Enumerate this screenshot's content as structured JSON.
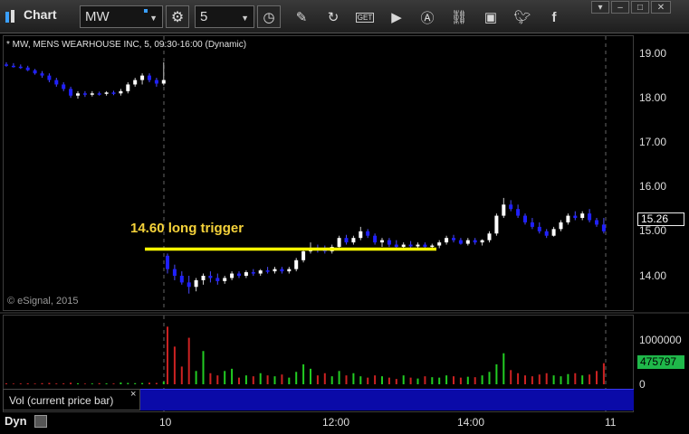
{
  "toolbar": {
    "app_title": "Chart",
    "symbol_value": "MW",
    "interval_value": "5"
  },
  "chart": {
    "symbol_info": "* MW, MENS WEARHOUSE INC, 5, 09:30-16:00 (Dynamic)",
    "copyright": "© eSignal, 2015",
    "annotation": "14.60 long trigger",
    "last_price": "15.26",
    "price_ticks": [
      "19.00",
      "18.00",
      "17.00",
      "16.00",
      "15.00",
      "14.00"
    ],
    "volume_label": "Vol (current price bar)",
    "volume_close": "×",
    "volume_ticks": [
      "1000000",
      "0"
    ],
    "volume_last": "475797",
    "time_ticks": [
      "10",
      "12:00",
      "14:00",
      "11"
    ],
    "bottom_label": "Dyn"
  },
  "colors": {
    "up_candle": "#ffffff",
    "down_candle": "#2020ff",
    "trigger_line": "#ffff00",
    "volume_up": "#22cc22",
    "volume_down": "#cc2222"
  },
  "chart_data": {
    "type": "candlestick",
    "ylim": [
      13.5,
      19.3
    ],
    "trigger_price": 14.6,
    "sessions": [
      {
        "label": "prior day",
        "candles": [
          [
            18.75,
            18.8,
            18.7,
            18.72
          ],
          [
            18.72,
            18.78,
            18.68,
            18.7
          ],
          [
            18.7,
            18.75,
            18.65,
            18.68
          ],
          [
            18.68,
            18.72,
            18.6,
            18.62
          ],
          [
            18.62,
            18.65,
            18.52,
            18.55
          ],
          [
            18.55,
            18.6,
            18.45,
            18.5
          ],
          [
            18.5,
            18.55,
            18.35,
            18.4
          ],
          [
            18.4,
            18.45,
            18.25,
            18.3
          ],
          [
            18.3,
            18.35,
            18.15,
            18.2
          ],
          [
            18.2,
            18.25,
            18.0,
            18.05
          ],
          [
            18.05,
            18.15,
            17.98,
            18.1
          ],
          [
            18.1,
            18.15,
            18.02,
            18.08
          ],
          [
            18.08,
            18.15,
            18.03,
            18.1
          ],
          [
            18.1,
            18.14,
            18.05,
            18.09
          ],
          [
            18.09,
            18.15,
            18.05,
            18.12
          ],
          [
            18.12,
            18.16,
            18.06,
            18.1
          ],
          [
            18.1,
            18.2,
            18.05,
            18.15
          ],
          [
            18.15,
            18.35,
            18.1,
            18.3
          ],
          [
            18.3,
            18.45,
            18.25,
            18.4
          ],
          [
            18.4,
            18.55,
            18.3,
            18.5
          ],
          [
            18.5,
            18.55,
            18.35,
            18.4
          ],
          [
            18.4,
            18.45,
            18.25,
            18.32
          ],
          [
            18.32,
            18.8,
            18.28,
            18.4
          ]
        ]
      },
      {
        "label": "current day",
        "candles": [
          [
            14.45,
            14.5,
            14.05,
            14.15
          ],
          [
            14.15,
            14.25,
            13.9,
            14.0
          ],
          [
            14.0,
            14.1,
            13.8,
            13.85
          ],
          [
            13.85,
            14.0,
            13.6,
            13.75
          ],
          [
            13.75,
            13.95,
            13.65,
            13.9
          ],
          [
            13.9,
            14.05,
            13.8,
            14.0
          ],
          [
            14.0,
            14.1,
            13.85,
            13.95
          ],
          [
            13.95,
            14.05,
            13.8,
            13.88
          ],
          [
            13.88,
            14.0,
            13.82,
            13.95
          ],
          [
            13.95,
            14.1,
            13.9,
            14.05
          ],
          [
            14.05,
            14.1,
            13.95,
            14.0
          ],
          [
            14.0,
            14.12,
            13.95,
            14.08
          ],
          [
            14.08,
            14.15,
            14.0,
            14.05
          ],
          [
            14.05,
            14.15,
            14.0,
            14.12
          ],
          [
            14.12,
            14.2,
            14.05,
            14.1
          ],
          [
            14.1,
            14.2,
            14.05,
            14.15
          ],
          [
            14.15,
            14.2,
            14.05,
            14.1
          ],
          [
            14.1,
            14.2,
            14.05,
            14.15
          ],
          [
            14.15,
            14.4,
            14.1,
            14.35
          ],
          [
            14.35,
            14.6,
            14.3,
            14.55
          ],
          [
            14.55,
            14.75,
            14.5,
            14.62
          ],
          [
            14.62,
            14.7,
            14.52,
            14.6
          ],
          [
            14.6,
            14.68,
            14.5,
            14.55
          ],
          [
            14.55,
            14.7,
            14.5,
            14.65
          ],
          [
            14.65,
            14.9,
            14.6,
            14.85
          ],
          [
            14.85,
            14.92,
            14.7,
            14.75
          ],
          [
            14.75,
            14.9,
            14.7,
            14.85
          ],
          [
            14.85,
            15.1,
            14.8,
            15.0
          ],
          [
            15.0,
            15.05,
            14.85,
            14.9
          ],
          [
            14.9,
            14.95,
            14.7,
            14.75
          ],
          [
            14.75,
            14.85,
            14.65,
            14.8
          ],
          [
            14.8,
            14.85,
            14.65,
            14.7
          ],
          [
            14.7,
            14.8,
            14.6,
            14.65
          ],
          [
            14.65,
            14.75,
            14.6,
            14.7
          ],
          [
            14.7,
            14.78,
            14.62,
            14.66
          ],
          [
            14.66,
            14.75,
            14.6,
            14.7
          ],
          [
            14.7,
            14.75,
            14.6,
            14.65
          ],
          [
            14.65,
            14.72,
            14.58,
            14.68
          ],
          [
            14.68,
            14.8,
            14.62,
            14.75
          ],
          [
            14.75,
            14.9,
            14.7,
            14.85
          ],
          [
            14.85,
            14.92,
            14.75,
            14.8
          ],
          [
            14.8,
            14.85,
            14.7,
            14.72
          ],
          [
            14.72,
            14.85,
            14.68,
            14.8
          ],
          [
            14.8,
            14.85,
            14.7,
            14.75
          ],
          [
            14.75,
            14.82,
            14.68,
            14.8
          ],
          [
            14.8,
            15.0,
            14.75,
            14.95
          ],
          [
            14.95,
            15.4,
            14.9,
            15.35
          ],
          [
            15.35,
            15.75,
            15.3,
            15.6
          ],
          [
            15.6,
            15.7,
            15.45,
            15.5
          ],
          [
            15.5,
            15.6,
            15.3,
            15.35
          ],
          [
            15.35,
            15.4,
            15.15,
            15.2
          ],
          [
            15.2,
            15.3,
            15.05,
            15.1
          ],
          [
            15.1,
            15.2,
            14.95,
            15.0
          ],
          [
            15.0,
            15.05,
            14.85,
            14.9
          ],
          [
            14.9,
            15.1,
            14.88,
            15.05
          ],
          [
            15.05,
            15.25,
            15.0,
            15.2
          ],
          [
            15.2,
            15.4,
            15.15,
            15.35
          ],
          [
            15.35,
            15.45,
            15.25,
            15.3
          ],
          [
            15.3,
            15.45,
            15.25,
            15.4
          ],
          [
            15.4,
            15.5,
            15.2,
            15.25
          ],
          [
            15.25,
            15.3,
            15.1,
            15.15
          ],
          [
            15.15,
            15.3,
            14.95,
            15.0
          ]
        ]
      }
    ],
    "volume": {
      "prior_day": [
        20000,
        15000,
        18000,
        22000,
        16000,
        25000,
        30000,
        18000,
        20000,
        35000,
        22000,
        15000,
        18000,
        25000,
        20000,
        18000,
        40000,
        30000,
        25000,
        28000,
        35000,
        30000,
        60000
      ],
      "current_day": [
        1300000,
        850000,
        400000,
        1050000,
        300000,
        750000,
        250000,
        200000,
        300000,
        350000,
        150000,
        200000,
        180000,
        250000,
        200000,
        180000,
        220000,
        150000,
        280000,
        450000,
        350000,
        200000,
        250000,
        180000,
        300000,
        200000,
        250000,
        180000,
        150000,
        200000,
        180000,
        150000,
        120000,
        200000,
        150000,
        130000,
        180000,
        160000,
        150000,
        200000,
        180000,
        150000,
        170000,
        160000,
        200000,
        280000,
        450000,
        700000,
        320000,
        250000,
        200000,
        180000,
        220000,
        250000,
        200000,
        180000,
        230000,
        250000,
        200000,
        220000,
        300000,
        475797
      ]
    }
  }
}
